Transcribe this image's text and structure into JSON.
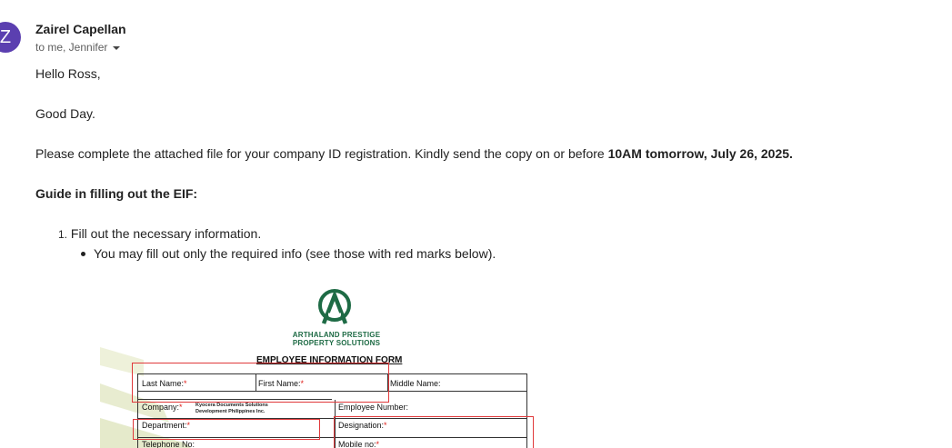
{
  "colors": {
    "avatar_bg": "#5b3fb0",
    "logo_green": "#1e6b45",
    "watermark": "#e6ebcf",
    "required_red": "#e0201b"
  },
  "email": {
    "avatar_letter": "Z",
    "sender_name": "Zairel Capellan",
    "recipients": "to me, Jennifer",
    "greeting": "Hello Ross,",
    "good_day": "Good Day.",
    "instruction_prefix": "Please complete the attached file for your company ID registration. Kindly send the copy on or before ",
    "instruction_deadline": "10AM tomorrow, July 26, 2025.",
    "guide_heading": "Guide in filling out the EIF:",
    "list_number": "1.",
    "list_item_1": "Fill out the necessary information.",
    "sub_bullet_1": "You may fill out only the required info (see those with red marks below)."
  },
  "form": {
    "company_line1": "ARTHALAND PRESTIGE",
    "company_line2": "PROPERTY SOLUTIONS",
    "title": "EMPLOYEE INFORMATION FORM",
    "required_mark": "*",
    "fields": {
      "last_name": "Last Name:",
      "first_name": "First Name:",
      "middle_name": "Middle Name:",
      "company": "Company:",
      "company_value_line1": "Kyocera Documents Solutions",
      "company_value_line2": "Development Philippines Inc.",
      "employee_number": "Employee Number:",
      "department": "Department:",
      "designation": "Designation:",
      "telephone": "Telephone No:",
      "mobile": "Mobile no:"
    }
  }
}
